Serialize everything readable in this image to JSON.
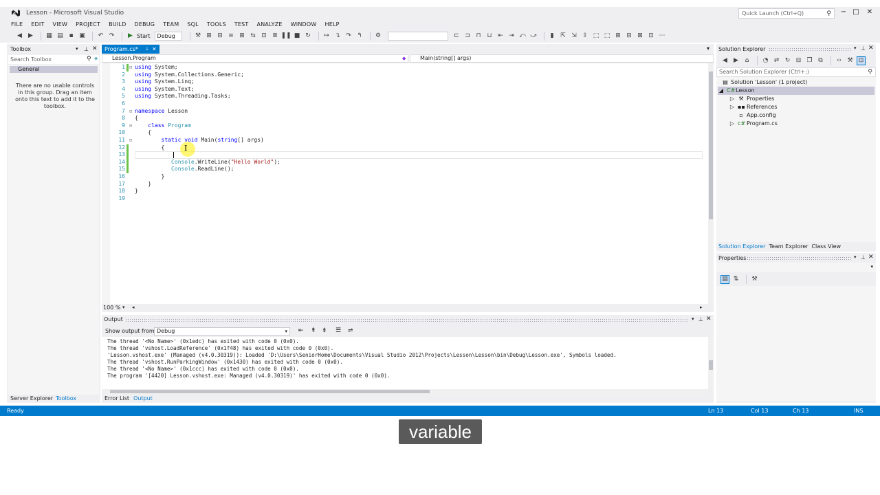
{
  "window": {
    "title": "Lesson - Microsoft Visual Studio",
    "quick_launch_placeholder": "Quick Launch (Ctrl+Q)"
  },
  "menu": [
    "FILE",
    "EDIT",
    "VIEW",
    "PROJECT",
    "BUILD",
    "DEBUG",
    "TEAM",
    "SQL",
    "TOOLS",
    "TEST",
    "ANALYZE",
    "WINDOW",
    "HELP"
  ],
  "toolbar": {
    "start_label": "Start",
    "config_value": "Debug"
  },
  "toolbox": {
    "title": "Toolbox",
    "search_placeholder": "Search Toolbox",
    "group": "General",
    "empty_message": "There are no usable controls in this group. Drag an item onto this text to add it to the toolbox."
  },
  "editor": {
    "tab_label": "Program.cs*",
    "nav_left": "Lesson.Program",
    "nav_right": "Main(string[] args)",
    "zoom": "100 %",
    "lines": [
      {
        "n": "1",
        "changed": true,
        "fold": "⊟",
        "html": "<span class='kw'>using</span> System;"
      },
      {
        "n": "2",
        "changed": false,
        "fold": "",
        "html": "<span class='kw'>using</span> System.Collections.Generic;"
      },
      {
        "n": "3",
        "changed": false,
        "fold": "",
        "html": "<span class='kw'>using</span> System.Linq;"
      },
      {
        "n": "4",
        "changed": false,
        "fold": "",
        "html": "<span class='kw'>using</span> System.Text;"
      },
      {
        "n": "5",
        "changed": false,
        "fold": "",
        "html": "<span class='kw'>using</span> System.Threading.Tasks;"
      },
      {
        "n": "6",
        "changed": false,
        "fold": "",
        "html": ""
      },
      {
        "n": "7",
        "changed": false,
        "fold": "⊟",
        "html": "<span class='kw'>namespace</span> Lesson"
      },
      {
        "n": "8",
        "changed": false,
        "fold": "",
        "html": "{"
      },
      {
        "n": "9",
        "changed": false,
        "fold": "⊟",
        "html": "    <span class='kw'>class</span> <span class='ty'>Program</span>"
      },
      {
        "n": "10",
        "changed": false,
        "fold": "",
        "html": "    {"
      },
      {
        "n": "11",
        "changed": false,
        "fold": "⊟",
        "html": "        <span class='kw'>static</span> <span class='kw'>void</span> Main(<span class='kw'>string</span>[] args)"
      },
      {
        "n": "12",
        "changed": true,
        "fold": "",
        "html": "        {"
      },
      {
        "n": "13",
        "changed": true,
        "fold": "",
        "html": ""
      },
      {
        "n": "14",
        "changed": true,
        "fold": "",
        "html": "           <span class='ty'>Console</span>.WriteLine(<span class='st'>\"Hello World\"</span>);"
      },
      {
        "n": "15",
        "changed": true,
        "fold": "",
        "html": "           <span class='ty'>Console</span>.ReadLine();"
      },
      {
        "n": "16",
        "changed": false,
        "fold": "",
        "html": "        }"
      },
      {
        "n": "17",
        "changed": false,
        "fold": "",
        "html": "    }"
      },
      {
        "n": "18",
        "changed": false,
        "fold": "",
        "html": "}"
      },
      {
        "n": "19",
        "changed": false,
        "fold": "",
        "html": ""
      }
    ]
  },
  "output": {
    "title": "Output",
    "show_from_label": "Show output from:",
    "source": "Debug",
    "lines": [
      "The thread '<No Name>' (0x1edc) has exited with code 0 (0x0).",
      "The thread 'vshost.LoadReference' (0x1f48) has exited with code 0 (0x0).",
      "'Lesson.vshost.exe' (Managed (v4.0.30319)): Loaded 'D:\\Users\\SeniorHome\\Documents\\Visual Studio 2012\\Projects\\Lesson\\Lesson\\bin\\Debug\\Lesson.exe', Symbols loaded.",
      "The thread 'vshost.RunParkingWindow' (0x1430) has exited with code 0 (0x0).",
      "The thread '<No Name>' (0x1ccc) has exited with code 0 (0x0).",
      "The program '[4420] Lesson.vshost.exe: Managed (v4.0.30319)' has exited with code 0 (0x0)."
    ]
  },
  "bottom_tabs": {
    "left": [
      "Server Explorer",
      "Toolbox"
    ],
    "center": [
      "Error List",
      "Output"
    ]
  },
  "solution_explorer": {
    "title": "Solution Explorer",
    "search_placeholder": "Search Solution Explorer (Ctrl+;)",
    "solution": "Solution 'Lesson' (1 project)",
    "project": "Lesson",
    "items": [
      "Properties",
      "References",
      "App.config",
      "Program.cs"
    ],
    "tabs": [
      "Solution Explorer",
      "Team Explorer",
      "Class View"
    ]
  },
  "properties": {
    "title": "Properties"
  },
  "status": {
    "ready": "Ready",
    "ln": "Ln 13",
    "col": "Col 13",
    "ch": "Ch 13",
    "mode": "INS"
  },
  "caption": "variable",
  "colors": {
    "accent": "#007acc",
    "keyword": "#0000ff",
    "type": "#2b91af",
    "string": "#a31515"
  }
}
